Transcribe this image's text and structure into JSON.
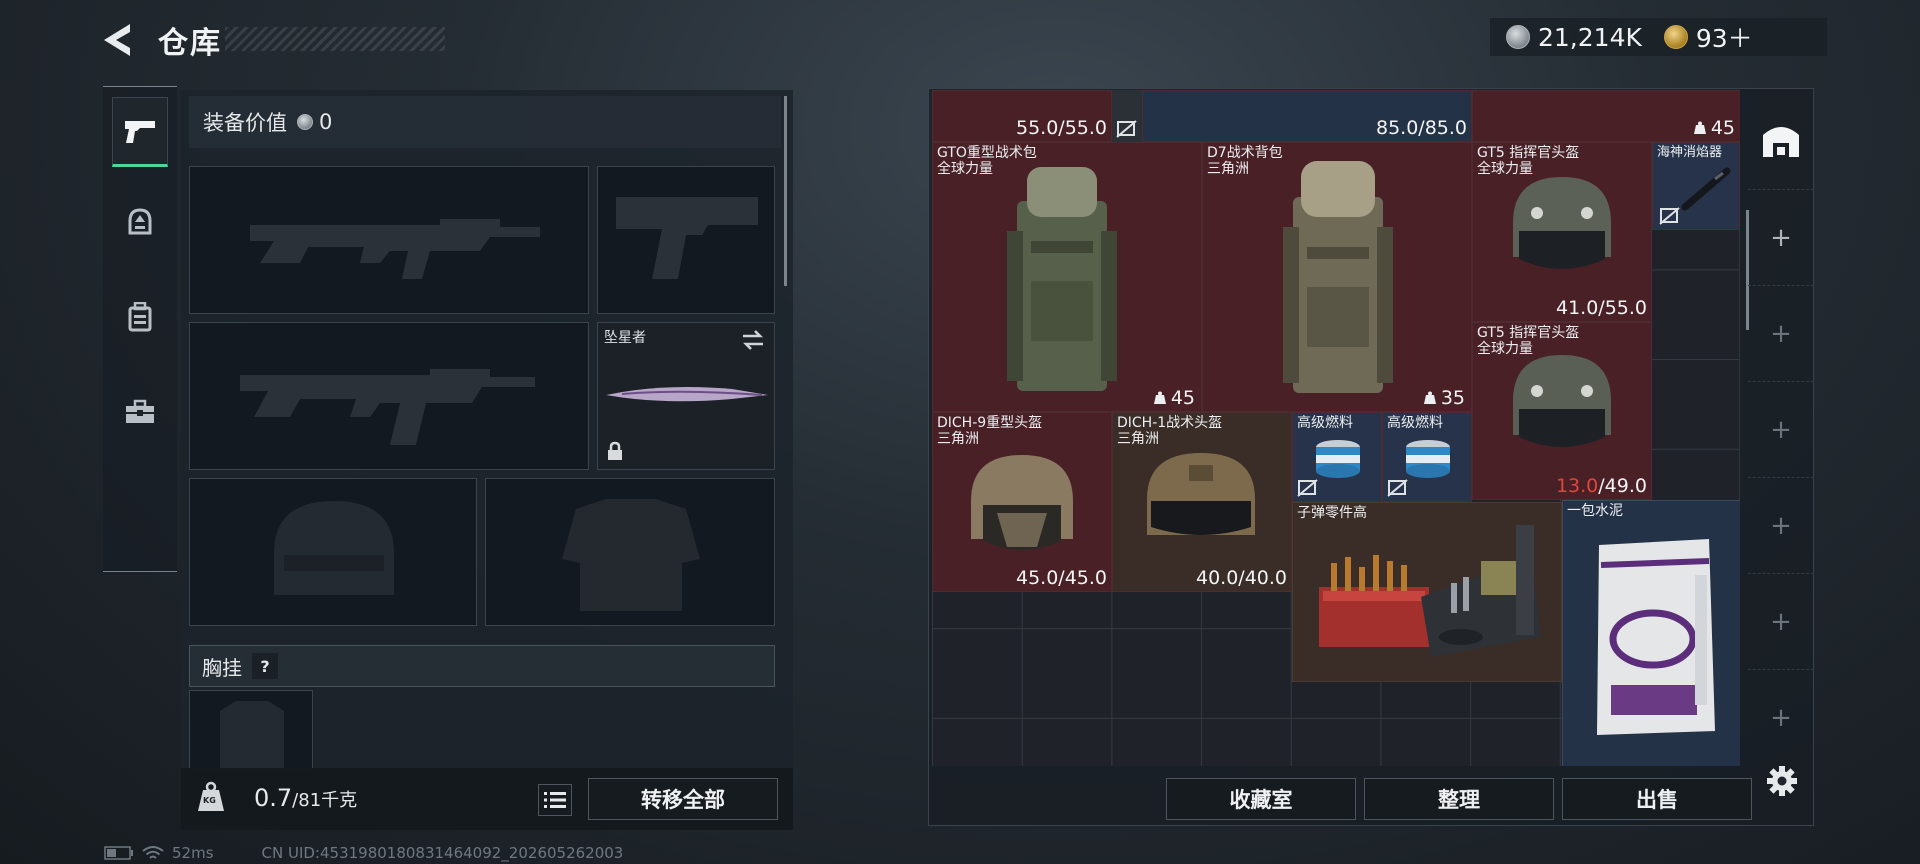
{
  "header": {
    "title": "仓库",
    "currencies": [
      {
        "icon": "silver-coin-icon",
        "value": "21,214K"
      },
      {
        "icon": "gold-coin-icon",
        "value": "93＋"
      }
    ]
  },
  "side_tabs": [
    {
      "icon": "pistol-icon",
      "active": true
    },
    {
      "icon": "helmet-icon",
      "active": false
    },
    {
      "icon": "backpack-icon",
      "active": false
    },
    {
      "icon": "toolbox-icon",
      "active": false
    }
  ],
  "loadout": {
    "value_label": "装备价值",
    "value": "0",
    "melee_name": "坠星者",
    "chest_label": "胸挂",
    "help_symbol": "?",
    "weight_current": "0.7",
    "weight_max": "/81千克",
    "weight_icon_text": "KG",
    "transfer_all": "转移全部"
  },
  "stash": {
    "top_durabilities": [
      "55.0/55.0",
      "85.0/85.0"
    ],
    "top_count": "45",
    "items": {
      "gto_bag": {
        "name": "GTO重型战术包",
        "sub": "全球力量",
        "count": "45"
      },
      "d7_bag": {
        "name": "D7战术背包",
        "sub": "三角洲",
        "count": "35"
      },
      "gt5_a": {
        "name": "GT5 指挥官头盔",
        "sub": "全球力量",
        "durability": "41.0/55.0"
      },
      "silencer": {
        "name": "海神消焰器"
      },
      "gt5_b": {
        "name": "GT5 指挥官头盔",
        "sub": "全球力量",
        "durability_current": "13.0",
        "durability_max": "/49.0"
      },
      "dich9": {
        "name": "DICH-9重型头盔",
        "sub": "三角洲",
        "durability": "45.0/45.0"
      },
      "dich1": {
        "name": "DICH-1战术头盔",
        "sub": "三角洲",
        "durability": "40.0/40.0"
      },
      "fuel_a": {
        "name": "高级燃料"
      },
      "fuel_b": {
        "name": "高级燃料"
      },
      "bullet_parts": {
        "name": "子弹零件高"
      },
      "cement": {
        "name": "一包水泥"
      }
    },
    "buttons": {
      "collection": "收藏室",
      "sort": "整理",
      "sell": "出售"
    }
  },
  "status": {
    "ping": "52ms",
    "uid": "CN UID:4531980180831464092_202605262003"
  }
}
